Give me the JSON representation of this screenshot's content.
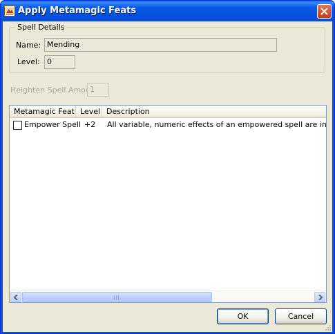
{
  "window": {
    "title": "Apply Metamagic Feats"
  },
  "spell_details": {
    "legend": "Spell Details",
    "name_label": "Name:",
    "name_value": "Mending",
    "level_label": "Level:",
    "level_value": "0"
  },
  "heighten": {
    "label": "Heighten Spell Amount",
    "value": "1",
    "enabled": false
  },
  "feats_list": {
    "columns": [
      "Metamagic Feat",
      "Level",
      "Description"
    ],
    "rows": [
      {
        "checked": false,
        "feat": "Empower Spell",
        "level": "+2",
        "description": "All variable, numeric effects of an empowered spell are increased by"
      }
    ]
  },
  "buttons": {
    "ok": "OK",
    "cancel": "Cancel"
  },
  "colors": {
    "titlebar": "#0054e3",
    "close_button": "#d8573b",
    "dialog_face": "#ece9d8",
    "list_border": "#7f9db9",
    "scroll_thumb": "#c1d3fb"
  }
}
